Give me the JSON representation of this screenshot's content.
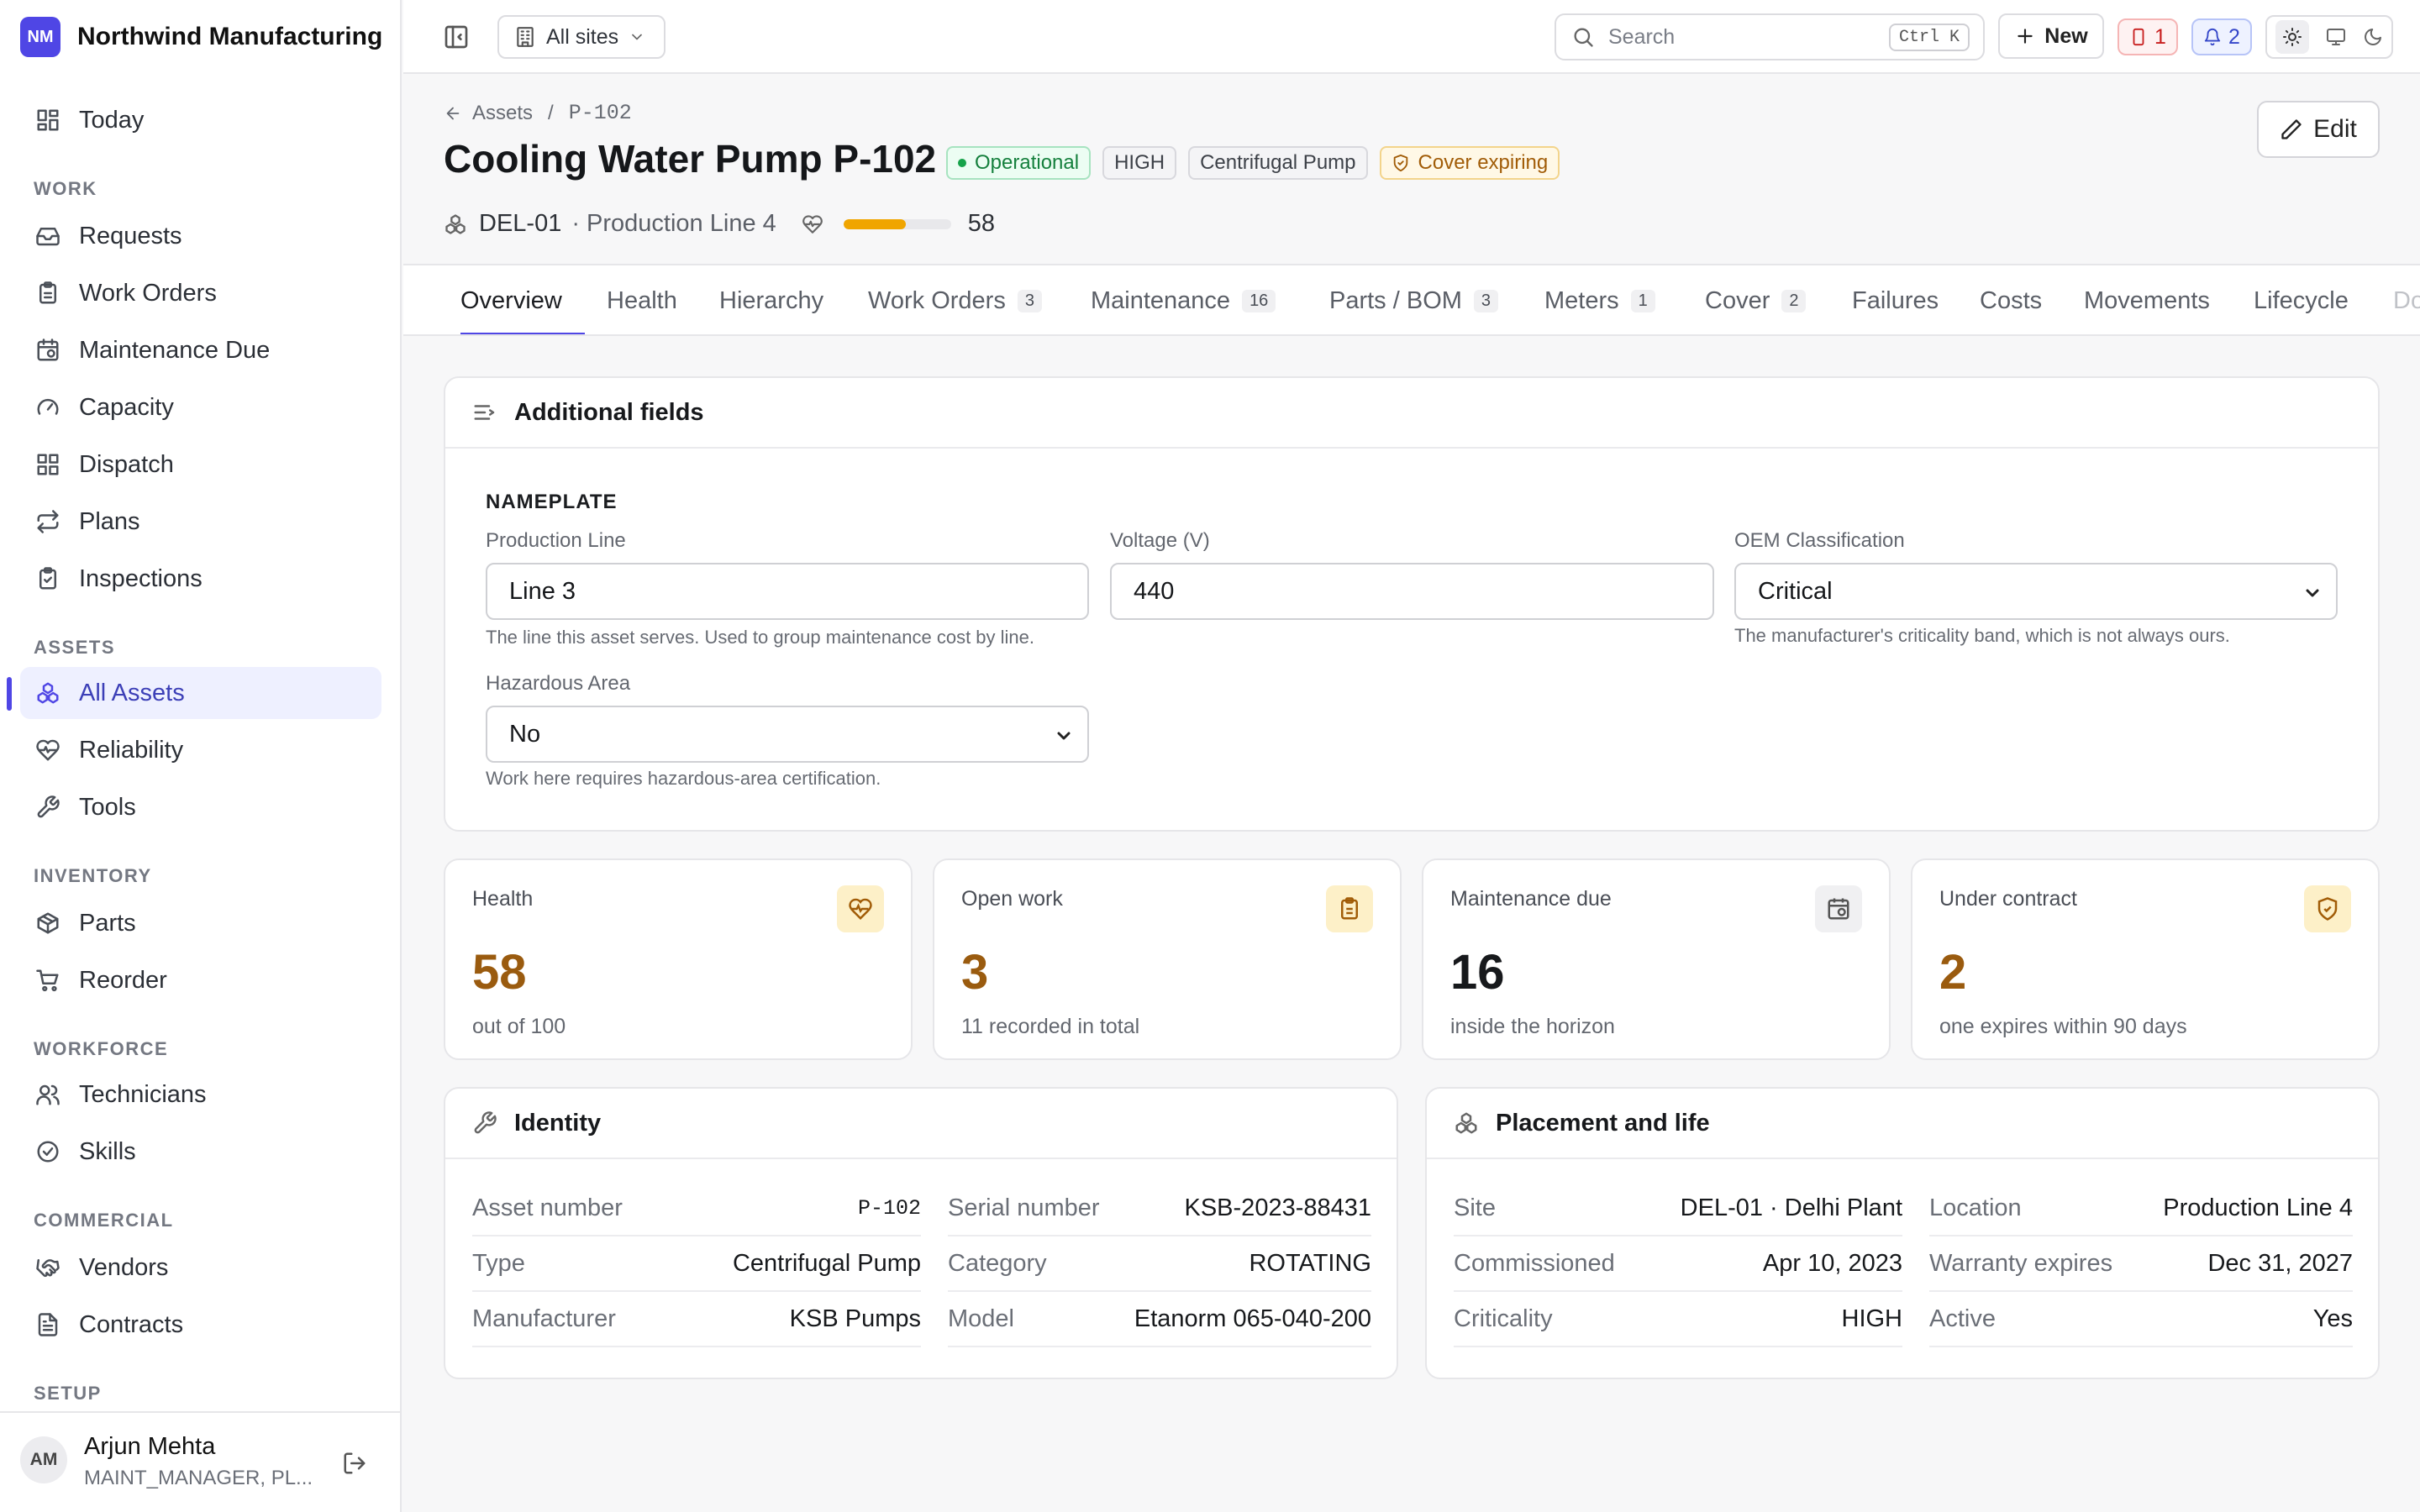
{
  "app": {
    "logo": "NM",
    "name": "Northwind Manufacturing"
  },
  "sidebar": {
    "today": "Today",
    "sections": {
      "work": "WORK",
      "assets": "ASSETS",
      "inventory": "INVENTORY",
      "workforce": "WORKFORCE",
      "commercial": "COMMERCIAL",
      "setup": "SETUP"
    },
    "work": [
      "Requests",
      "Work Orders",
      "Maintenance Due",
      "Capacity",
      "Dispatch",
      "Plans",
      "Inspections"
    ],
    "assets": [
      "All Assets",
      "Reliability",
      "Tools"
    ],
    "inventory": [
      "Parts",
      "Reorder"
    ],
    "workforce": [
      "Technicians",
      "Skills"
    ],
    "commercial": [
      "Vendors",
      "Contracts"
    ]
  },
  "user": {
    "initials": "AM",
    "name": "Arjun Mehta",
    "role": "MAINT_MANAGER, PL..."
  },
  "topbar": {
    "site": "All sites",
    "search_placeholder": "Search",
    "shortcut": "Ctrl K",
    "new_label": "New",
    "alerts_count": "1",
    "notif_count": "2"
  },
  "breadcrumb": {
    "parent": "Assets",
    "separator": "/",
    "current": "P-102"
  },
  "asset": {
    "title": "Cooling Water Pump P-102",
    "status": "Operational",
    "criticality": "HIGH",
    "type": "Centrifugal Pump",
    "cover": "Cover expiring",
    "site_code": "DEL-01",
    "location": "· Production Line 4",
    "health": "58",
    "health_fraction": 0.58
  },
  "edit_label": "Edit",
  "tabs": [
    {
      "label": "Overview",
      "count": ""
    },
    {
      "label": "Health",
      "count": ""
    },
    {
      "label": "Hierarchy",
      "count": ""
    },
    {
      "label": "Work Orders",
      "count": "3"
    },
    {
      "label": "Maintenance",
      "count": "16"
    },
    {
      "label": "Parts / BOM",
      "count": "3"
    },
    {
      "label": "Meters",
      "count": "1"
    },
    {
      "label": "Cover",
      "count": "2"
    },
    {
      "label": "Failures",
      "count": ""
    },
    {
      "label": "Costs",
      "count": ""
    },
    {
      "label": "Movements",
      "count": ""
    },
    {
      "label": "Lifecycle",
      "count": ""
    },
    {
      "label": "Do",
      "count": ""
    }
  ],
  "additional": {
    "title": "Additional fields",
    "group": "NAMEPLATE",
    "production_line": {
      "label": "Production Line",
      "value": "Line 3",
      "help": "The line this asset serves. Used to group maintenance cost by line."
    },
    "voltage": {
      "label": "Voltage (V)",
      "value": "440"
    },
    "oem": {
      "label": "OEM Classification",
      "value": "Critical",
      "help": "The manufacturer's criticality band, which is not always ours."
    },
    "hazardous": {
      "label": "Hazardous Area",
      "value": "No",
      "help": "Work here requires hazardous-area certification."
    }
  },
  "stats": [
    {
      "label": "Health",
      "value": "58",
      "sub": "out of 100",
      "color": "#9a5b0f"
    },
    {
      "label": "Open work",
      "value": "3",
      "sub": "11 recorded in total",
      "color": "#9a5b0f"
    },
    {
      "label": "Maintenance due",
      "value": "16",
      "sub": "inside the horizon",
      "color": "#17191c"
    },
    {
      "label": "Under contract",
      "value": "2",
      "sub": "one expires within 90 days",
      "color": "#9a5b0f"
    }
  ],
  "identity": {
    "title": "Identity",
    "rows": [
      {
        "k": "Asset number",
        "v": "P-102"
      },
      {
        "k": "Serial number",
        "v": "KSB-2023-88431"
      },
      {
        "k": "Type",
        "v": "Centrifugal Pump"
      },
      {
        "k": "Category",
        "v": "ROTATING"
      },
      {
        "k": "Manufacturer",
        "v": "KSB Pumps"
      },
      {
        "k": "Model",
        "v": "Etanorm 065-040-200"
      }
    ]
  },
  "placement": {
    "title": "Placement and life",
    "rows": [
      {
        "k": "Site",
        "v": "DEL-01 · Delhi Plant"
      },
      {
        "k": "Location",
        "v": "Production Line 4"
      },
      {
        "k": "Commissioned",
        "v": "Apr 10, 2023"
      },
      {
        "k": "Warranty expires",
        "v": "Dec 31, 2027"
      },
      {
        "k": "Criticality",
        "v": "HIGH"
      },
      {
        "k": "Active",
        "v": "Yes"
      }
    ]
  },
  "colors": {
    "accent": "#4f46e5",
    "operational": "#15803d",
    "warning": "#b45309",
    "health_bar": "#f0a500"
  }
}
